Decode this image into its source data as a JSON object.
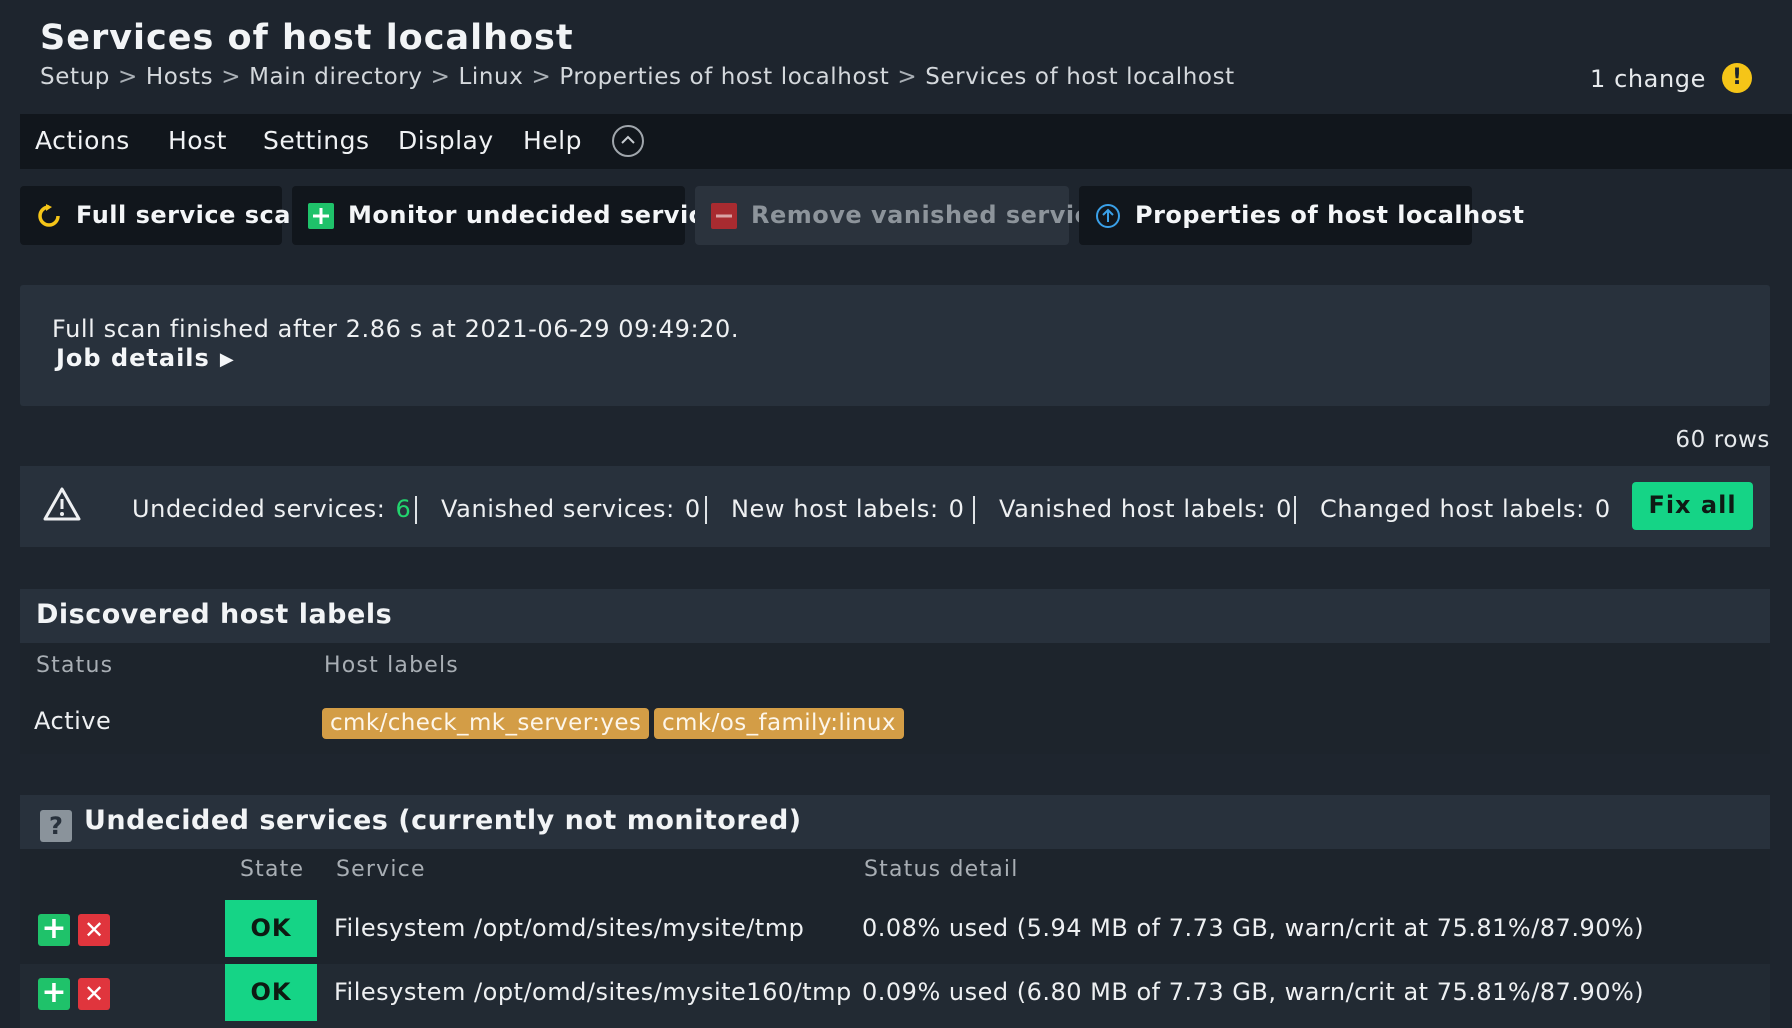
{
  "header": {
    "title": "Services of host localhost",
    "breadcrumb": [
      "Setup",
      "Hosts",
      "Main directory",
      "Linux",
      "Properties of host localhost",
      "Services of host localhost"
    ],
    "breadcrumb_separator": ">",
    "change_text": "1 change",
    "change_icon": "!"
  },
  "menu": {
    "items": [
      "Actions",
      "Host",
      "Settings",
      "Display",
      "Help"
    ]
  },
  "buttons": {
    "full_scan": "Full service scan",
    "monitor_undecided": "Monitor undecided services",
    "remove_vanished": "Remove vanished services",
    "properties": "Properties of host localhost"
  },
  "scan": {
    "message": "Full scan finished after 2.86 s at 2021-06-29 09:49:20.",
    "job_details": "Job details"
  },
  "rows_count": "60 rows",
  "summary": {
    "undecided_label": "Undecided services:",
    "undecided_value": "6",
    "vanished_label": "Vanished services:",
    "vanished_value": "0",
    "new_labels_label": "New host labels:",
    "new_labels_value": "0",
    "vanished_labels_label": "Vanished host labels:",
    "vanished_labels_value": "0",
    "changed_labels_label": "Changed host labels:",
    "changed_labels_value": "0",
    "fix_all": "Fix all"
  },
  "host_labels": {
    "title": "Discovered host labels",
    "columns": [
      "Status",
      "Host labels"
    ],
    "row": {
      "status": "Active",
      "labels": [
        "cmk/check_mk_server:yes",
        "cmk/os_family:linux"
      ]
    }
  },
  "undecided": {
    "icon": "?",
    "title": "Undecided services (currently not monitored)",
    "columns": [
      "State",
      "Service",
      "Status detail"
    ],
    "rows": [
      {
        "state": "OK",
        "service": "Filesystem /opt/omd/sites/mysite/tmp",
        "detail": "0.08% used (5.94 MB of 7.73 GB, warn/crit at 75.81%/87.90%)"
      },
      {
        "state": "OK",
        "service": "Filesystem /opt/omd/sites/mysite160/tmp",
        "detail": "0.09% used (6.80 MB of 7.73 GB, warn/crit at 75.81%/87.90%)"
      }
    ]
  },
  "colors": {
    "background": "#1e252e",
    "ok_green": "#15d486",
    "warning_yellow": "#f5c518",
    "label_chip": "#d39d46",
    "delete_red": "#e0353d"
  }
}
